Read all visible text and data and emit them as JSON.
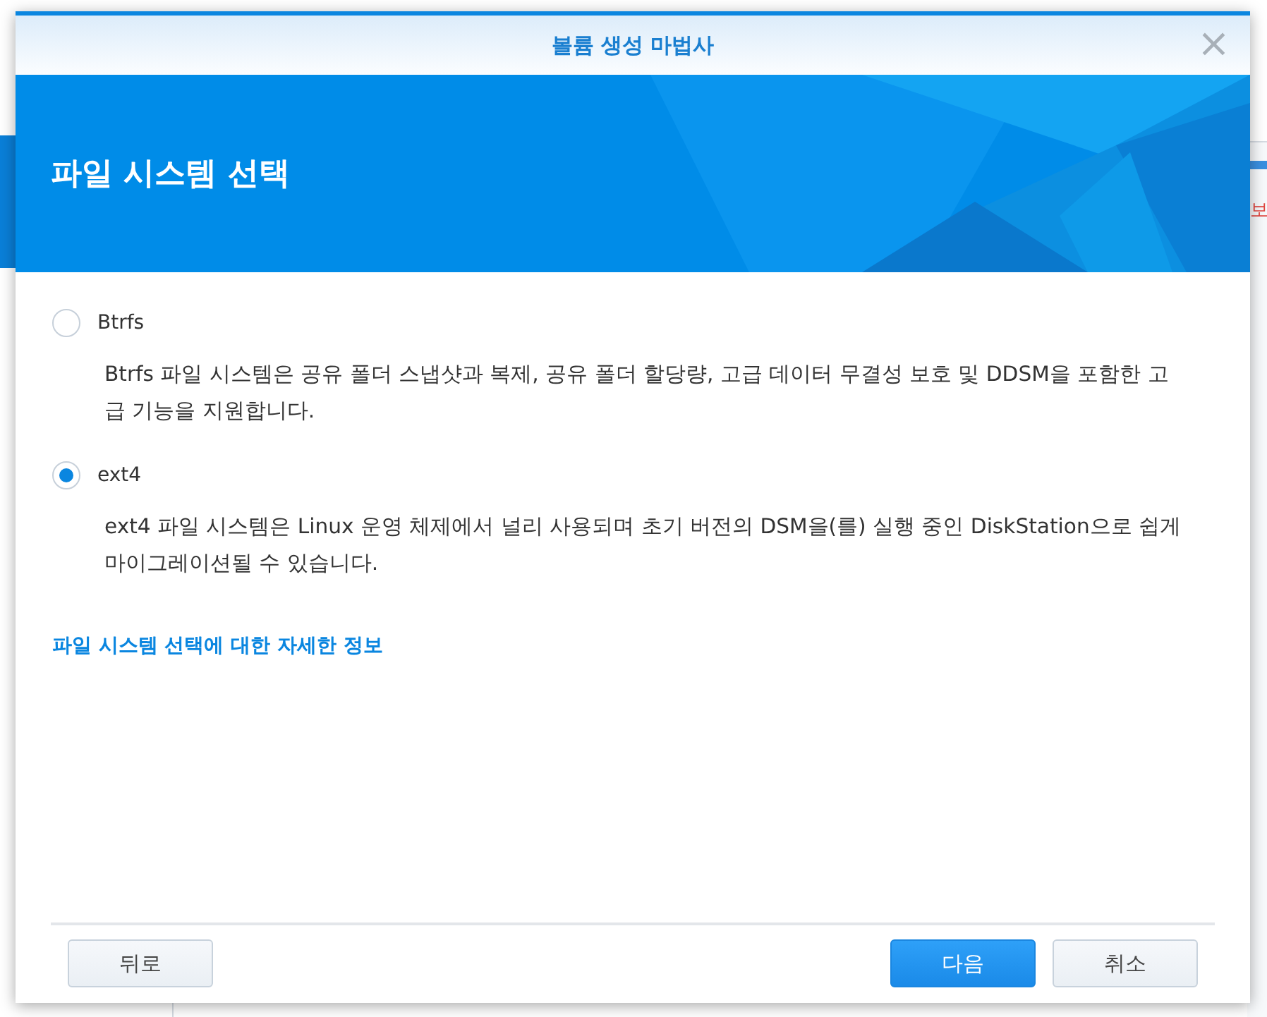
{
  "background_window": {
    "side_text": "보"
  },
  "dialog": {
    "title": "볼륨 생성 마법사",
    "close": "×",
    "heading": "파일 시스템 선택",
    "options": [
      {
        "label": "Btrfs",
        "selected": false,
        "description": "Btrfs 파일 시스템은 공유 폴더 스냅샷과 복제, 공유 폴더 할당량, 고급 데이터 무결성 보호 및 DDSM을 포함한 고급 기능을 지원합니다."
      },
      {
        "label": "ext4",
        "selected": true,
        "description": "ext4 파일 시스템은 Linux 운영 체제에서 널리 사용되며 초기 버전의 DSM을(를) 실행 중인 DiskStation으로 쉽게 마이그레이션될 수 있습니다."
      }
    ],
    "link": "파일 시스템 선택에 대한 자세한 정보",
    "buttons": [
      {
        "label": "뒤로",
        "kind": "secondary"
      },
      {
        "label": "다음",
        "kind": "primary"
      },
      {
        "label": "취소",
        "kind": "secondary"
      }
    ]
  }
}
